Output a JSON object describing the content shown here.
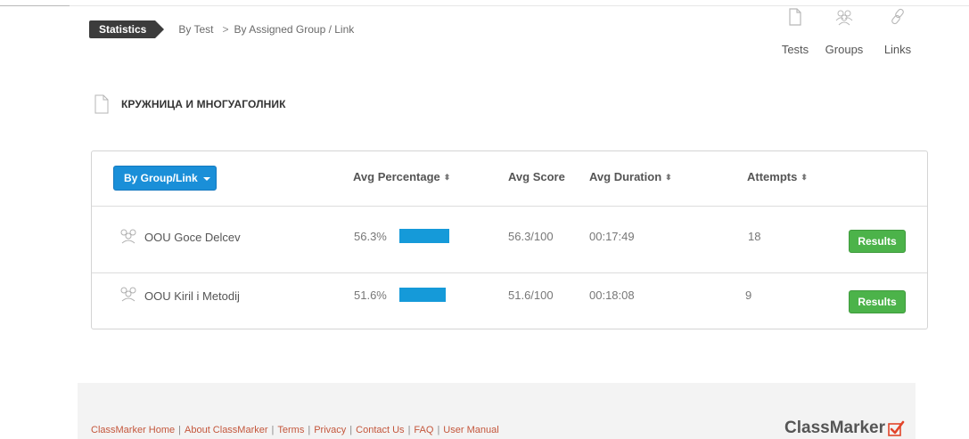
{
  "breadcrumb": {
    "active": "Statistics",
    "items": [
      "By Test",
      "By Assigned Group / Link"
    ],
    "separator": ">"
  },
  "topnav": {
    "items": [
      {
        "label": "Tests",
        "icon": "document-icon"
      },
      {
        "label": "Groups",
        "icon": "group-icon"
      },
      {
        "label": "Links",
        "icon": "link-icon"
      }
    ]
  },
  "test": {
    "icon": "document-icon",
    "name": "КРУЖНИЦА И МНОГУАГОЛНИК"
  },
  "table": {
    "group_button": "By Group/Link",
    "headers": {
      "percentage": "Avg Percentage",
      "score": "Avg Score",
      "duration": "Avg Duration",
      "attempts": "Attempts"
    },
    "sort_glyph": "⬍",
    "rows": [
      {
        "name": "OOU Goce Delcev",
        "percentage": "56.3%",
        "percentage_value": 56.3,
        "score": "56.3/100",
        "duration": "00:17:49",
        "attempts": "18",
        "action": "Results"
      },
      {
        "name": "OOU Kiril i Metodij",
        "percentage": "51.6%",
        "percentage_value": 51.6,
        "score": "51.6/100",
        "duration": "00:18:08",
        "attempts": "9",
        "action": "Results"
      }
    ]
  },
  "footer": {
    "links": [
      "ClassMarker Home",
      "About ClassMarker",
      "Terms",
      "Privacy",
      "Contact Us",
      "FAQ",
      "User Manual"
    ],
    "separator": "|",
    "brand": "ClassMarker"
  },
  "colors": {
    "primary_button": "#1a8fd8",
    "progress_bar": "#159ad9",
    "results_button": "#4cb34a",
    "footer_link": "#c4573c",
    "brand_check": "#e2452b"
  }
}
